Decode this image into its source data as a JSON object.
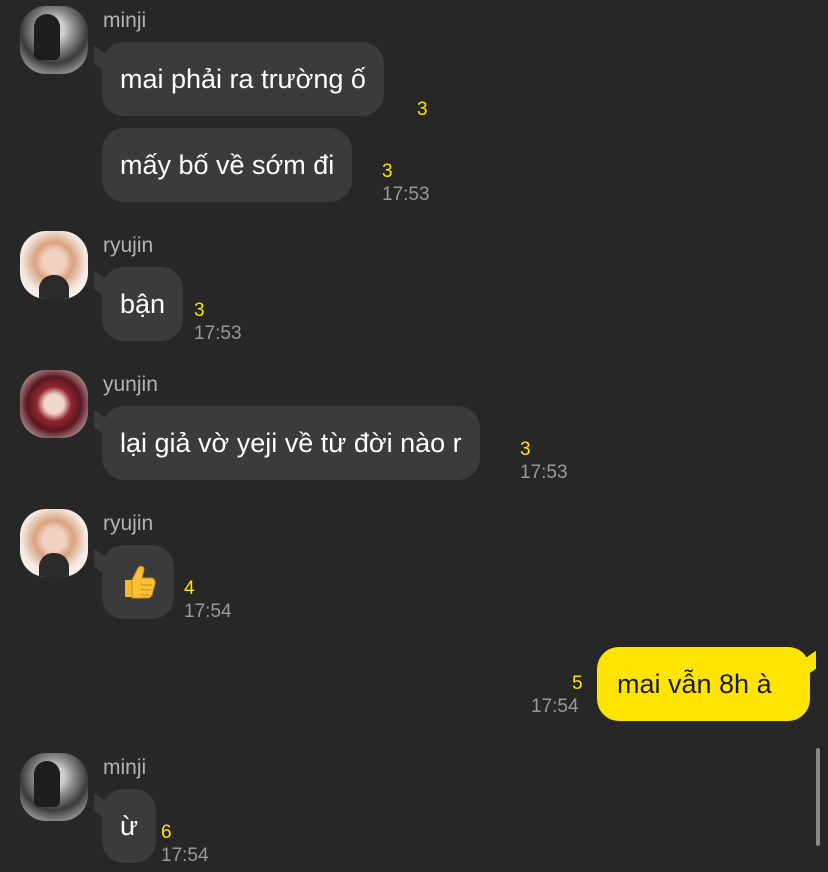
{
  "colors": {
    "background": "#272727",
    "bubble_other": "#3b3b3b",
    "bubble_mine": "#fee500",
    "unread": "#fee500"
  },
  "messages": [
    {
      "sender": "minji",
      "avatar": "minji-avatar-icon",
      "text": "mai phải ra trường ố",
      "unread": "3",
      "time": ""
    },
    {
      "sender": "",
      "text": "mấy bố về sớm đi",
      "unread": "3",
      "time": "17:53"
    },
    {
      "sender": "ryujin",
      "avatar": "ryujin-avatar-icon",
      "text": "bận",
      "unread": "3",
      "time": "17:53"
    },
    {
      "sender": "yunjin",
      "avatar": "yunjin-avatar-icon",
      "text": "lại giả vờ yeji về từ đời nào r",
      "unread": "3",
      "time": "17:53"
    },
    {
      "sender": "ryujin",
      "avatar": "ryujin-avatar-icon",
      "emoji": "thumbs-up-icon",
      "unread": "4",
      "time": "17:54"
    },
    {
      "sender": "me",
      "text": "mai vẫn 8h à",
      "unread": "5",
      "time": "17:54"
    },
    {
      "sender": "minji",
      "avatar": "minji-avatar-icon",
      "text": "ừ",
      "unread": "6",
      "time": "17:54"
    }
  ]
}
